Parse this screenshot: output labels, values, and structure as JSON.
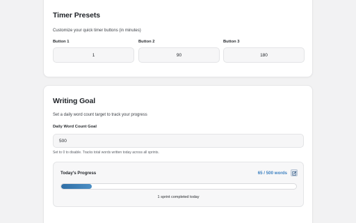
{
  "presets": {
    "title": "Timer Presets",
    "description": "Customize your quick timer buttons (in minutes)",
    "buttons": [
      {
        "label": "Button 1",
        "value": "1"
      },
      {
        "label": "Button 2",
        "value": "90"
      },
      {
        "label": "Button 3",
        "value": "180"
      }
    ]
  },
  "goal": {
    "title": "Writing Goal",
    "description": "Set a daily word count target to track your progress",
    "field_label": "Daily Word Count Goal",
    "field_value": "500",
    "hint": "Set to 0 to disable. Tracks total words written today across all sprints.",
    "progress": {
      "title": "Today's Progress",
      "count_text": "65 / 500 words",
      "fraction": 0.13,
      "caption": "1 sprint completed today",
      "edit_icon": "edit-icon",
      "accent": "#3a7fc0"
    }
  }
}
